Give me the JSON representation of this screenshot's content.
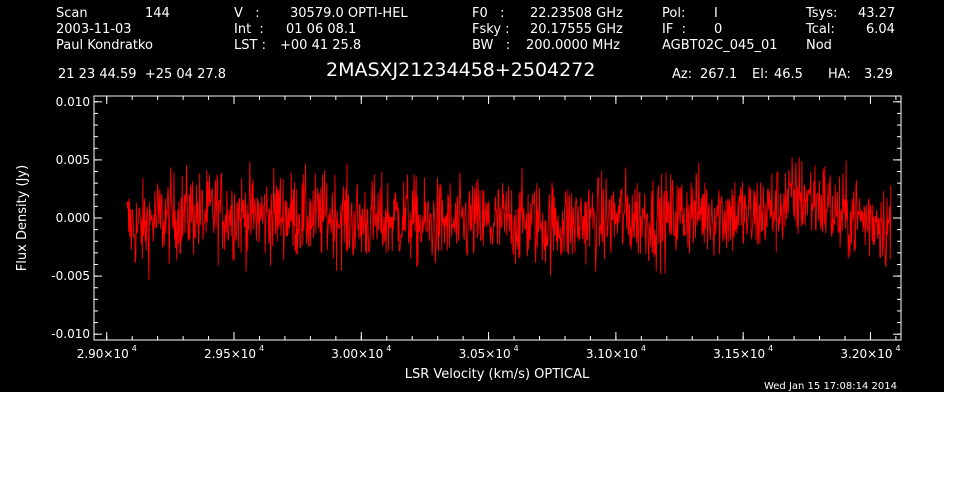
{
  "header": {
    "scan_label": "Scan",
    "scan_value": "144",
    "date": "2003-11-03",
    "observer": "Paul Kondratko",
    "v_label": "V   :",
    "v_value": "30579.0 OPTI-HEL",
    "int_label": "Int  :",
    "int_value": "01 06 08.1",
    "lst_label": "LST :",
    "lst_value": "+00 41 25.8",
    "f0_label": "F0   :",
    "f0_value": "22.23508 GHz",
    "fsky_label": "Fsky :",
    "fsky_value": "20.17555 GHz",
    "bw_label": "BW   :",
    "bw_value": "200.0000 MHz",
    "pol_label": "Pol:",
    "pol_value": "I",
    "if_label": "IF  :",
    "if_value": "0",
    "project": "AGBT02C_045_01",
    "tsys_label": "Tsys:",
    "tsys_value": "43.27",
    "tcal_label": "Tcal:",
    "tcal_value": "6.04",
    "mode": "Nod",
    "coords": "21 23 44.59  +25 04 27.8",
    "source": "2MASXJ21234458+2504272",
    "az_label": "Az:",
    "az_value": "267.1",
    "el_label": "El:",
    "el_value": "46.5",
    "ha_label": "HA:",
    "ha_value": "3.29"
  },
  "timestamp": "Wed Jan 15 17:08:14 2014",
  "colors": {
    "background": "#000000",
    "axes": "#ffffff",
    "trace": "#ff0000"
  },
  "chart_data": {
    "type": "line",
    "title": "2MASXJ21234458+2504272",
    "xlabel": "LSR Velocity (km/s) OPTICAL",
    "ylabel": "Flux Density (Jy)",
    "xlim": [
      28950,
      32120
    ],
    "ylim": [
      -0.0105,
      0.0105
    ],
    "x_ticks": [
      29000,
      29500,
      30000,
      30500,
      31000,
      31500,
      32000
    ],
    "x_tick_labels": [
      "2.90×10",
      "2.95×10",
      "3.00×10",
      "3.05×10",
      "3.10×10",
      "3.15×10",
      "3.20×10"
    ],
    "x_tick_exponent": "4",
    "y_ticks": [
      0.01,
      0.005,
      0.0,
      -0.005,
      -0.01
    ],
    "y_tick_labels": [
      "0.010",
      "0.005",
      "0.000",
      "-0.005",
      "-0.010"
    ],
    "grid": false,
    "series": [
      {
        "color": "#ff0000",
        "x": [
          29080,
          29130,
          29180,
          29230,
          29280,
          29330,
          29380,
          29430,
          29480,
          29530,
          29580,
          29630,
          29680,
          29730,
          29780,
          29830,
          29880,
          29930,
          29980,
          30030,
          30080,
          30130,
          30180,
          30230,
          30280,
          30330,
          30380,
          30430,
          30480,
          30530,
          30580,
          30630,
          30680,
          30730,
          30780,
          30830,
          30880,
          30930,
          30980,
          31030,
          31080,
          31130,
          31180,
          31230,
          31280,
          31330,
          31380,
          31430,
          31480,
          31530,
          31580,
          31630,
          31680,
          31730,
          31780,
          31830,
          31880,
          31930,
          31980,
          32030,
          32080
        ],
        "y": [
          -0.0005,
          -0.001,
          -0.0002,
          0.0,
          0.0002,
          0.0006,
          0.0001,
          0.0007,
          0.0004,
          0.0003,
          0.0002,
          0.0001,
          0.0005,
          0.0002,
          0.0001,
          0.0,
          0.0003,
          0.0,
          -0.0004,
          -0.0002,
          -0.0003,
          0.0,
          0.0001,
          -0.0006,
          -0.0005,
          -0.0004,
          -0.0008,
          -0.0002,
          -0.0005,
          -0.0006,
          -0.0002,
          -0.0004,
          -0.0003,
          -0.0007,
          -0.0004,
          -0.0005,
          -0.0001,
          -0.0003,
          0.0,
          0.0002,
          0.0001,
          0.0,
          -0.0002,
          0.0002,
          0.0004,
          0.0006,
          0.0005,
          0.0003,
          0.0004,
          0.0,
          0.0005,
          0.0008,
          0.0015,
          0.0018,
          0.0016,
          0.0012,
          0.0,
          0.0002,
          -0.0002,
          0.0,
          -0.0008
        ]
      }
    ]
  }
}
